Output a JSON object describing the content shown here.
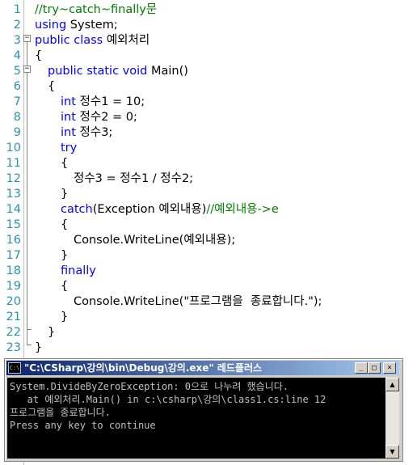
{
  "editor": {
    "lines": [
      {
        "n": "1",
        "indent": 0,
        "parts": [
          {
            "t": "//try~catch~finally문",
            "c": "cm"
          }
        ]
      },
      {
        "n": "2",
        "indent": 0,
        "parts": [
          {
            "t": "using",
            "c": "kw"
          },
          {
            "t": " System;",
            "c": "tx"
          }
        ]
      },
      {
        "n": "3",
        "indent": 0,
        "parts": [
          {
            "t": "public class",
            "c": "kw"
          },
          {
            "t": " 예외처리",
            "c": "tx"
          }
        ]
      },
      {
        "n": "4",
        "indent": 0,
        "parts": [
          {
            "t": "{",
            "c": "tx"
          }
        ]
      },
      {
        "n": "5",
        "indent": 1,
        "parts": [
          {
            "t": "public static void",
            "c": "kw"
          },
          {
            "t": " Main()",
            "c": "tx"
          }
        ]
      },
      {
        "n": "6",
        "indent": 1,
        "parts": [
          {
            "t": "{",
            "c": "tx"
          }
        ]
      },
      {
        "n": "7",
        "indent": 2,
        "parts": [
          {
            "t": "int",
            "c": "kw"
          },
          {
            "t": " 정수1 = 10;",
            "c": "tx"
          }
        ]
      },
      {
        "n": "8",
        "indent": 2,
        "parts": [
          {
            "t": "int",
            "c": "kw"
          },
          {
            "t": " 정수2 = 0;",
            "c": "tx"
          }
        ]
      },
      {
        "n": "9",
        "indent": 2,
        "parts": [
          {
            "t": "int",
            "c": "kw"
          },
          {
            "t": " 정수3;",
            "c": "tx"
          }
        ]
      },
      {
        "n": "10",
        "indent": 2,
        "parts": [
          {
            "t": "try",
            "c": "kw"
          }
        ]
      },
      {
        "n": "11",
        "indent": 2,
        "parts": [
          {
            "t": "{",
            "c": "tx"
          }
        ]
      },
      {
        "n": "12",
        "indent": 3,
        "parts": [
          {
            "t": "정수3 = 정수1 / 정수2;",
            "c": "tx"
          }
        ]
      },
      {
        "n": "13",
        "indent": 2,
        "parts": [
          {
            "t": "}",
            "c": "tx"
          }
        ]
      },
      {
        "n": "14",
        "indent": 2,
        "parts": [
          {
            "t": "catch",
            "c": "kw"
          },
          {
            "t": "(Exception 예외내용)",
            "c": "tx"
          },
          {
            "t": "//예외내용->e",
            "c": "cm"
          }
        ]
      },
      {
        "n": "15",
        "indent": 2,
        "parts": [
          {
            "t": "{",
            "c": "tx"
          }
        ]
      },
      {
        "n": "16",
        "indent": 3,
        "parts": [
          {
            "t": "Console.WriteLine(예외내용);",
            "c": "tx"
          }
        ]
      },
      {
        "n": "17",
        "indent": 2,
        "parts": [
          {
            "t": "}",
            "c": "tx"
          }
        ]
      },
      {
        "n": "18",
        "indent": 2,
        "parts": [
          {
            "t": "finally",
            "c": "kw"
          }
        ]
      },
      {
        "n": "19",
        "indent": 2,
        "parts": [
          {
            "t": "{",
            "c": "tx"
          }
        ]
      },
      {
        "n": "20",
        "indent": 3,
        "parts": [
          {
            "t": "Console.WriteLine(\"프로그램을  종료합니다.\");",
            "c": "tx"
          }
        ]
      },
      {
        "n": "21",
        "indent": 2,
        "parts": [
          {
            "t": "}",
            "c": "tx"
          }
        ]
      },
      {
        "n": "22",
        "indent": 1,
        "parts": [
          {
            "t": "}",
            "c": "tx"
          }
        ]
      },
      {
        "n": "23",
        "indent": 0,
        "parts": [
          {
            "t": "}",
            "c": "tx"
          }
        ]
      }
    ],
    "fold_markers": {
      "class": "−",
      "method": "−"
    }
  },
  "console": {
    "icon_text": "C:\\",
    "title": "\"C:\\CSharp\\강의\\bin\\Debug\\강의.exe\" 레드플러스",
    "buttons": {
      "minimize": "_",
      "maximize": "□",
      "close": "×"
    },
    "output": [
      "System.DivideByZeroException: 0으로 나누려 했습니다.",
      "   at 예외처리.Main() in c:\\csharp\\강의\\class1.cs:line 12",
      "프로그램을 종료합니다.",
      "Press any key to continue"
    ],
    "scroll": {
      "up": "▲",
      "down": "▼"
    }
  },
  "colors": {
    "keyword": "#0000ff",
    "comment": "#008000",
    "line_number": "#2b91af",
    "console_bg": "#000000",
    "console_text": "#c0c0c0",
    "titlebar": "#0a246a"
  }
}
